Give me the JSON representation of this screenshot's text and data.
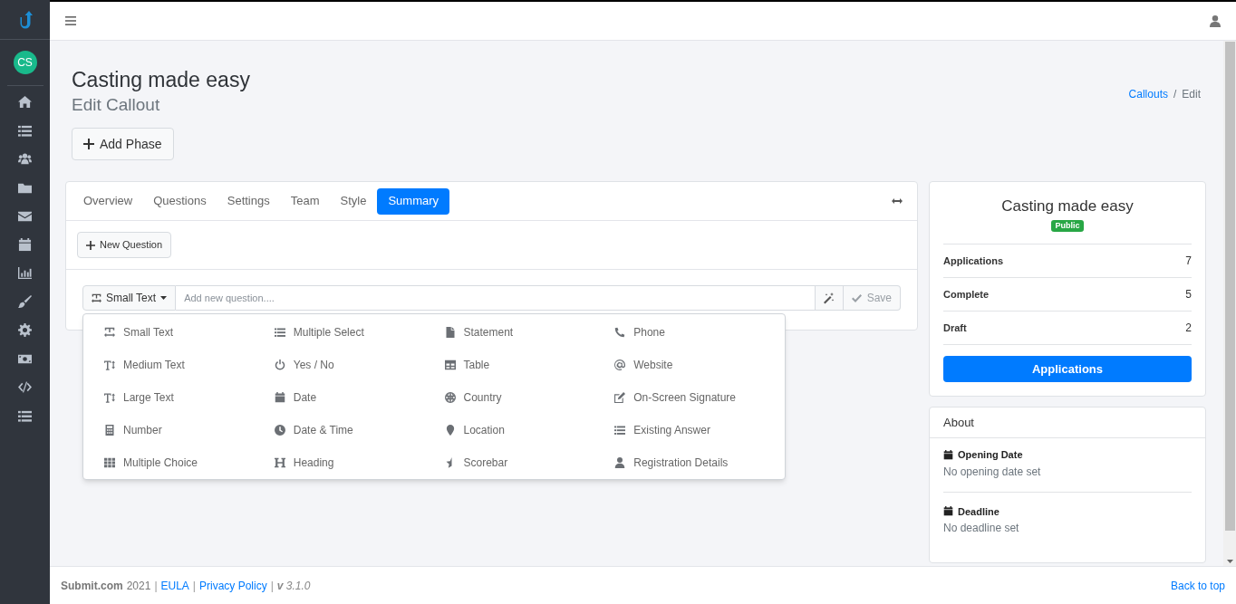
{
  "sidebar": {
    "avatar": "CS",
    "items": [
      {
        "selected": false
      },
      {
        "selected": false
      },
      {
        "selected": false
      },
      {
        "selected": false
      },
      {
        "selected": false
      },
      {
        "selected": false
      },
      {
        "selected": false
      },
      {
        "selected": false
      },
      {
        "selected": false
      },
      {
        "selected": false
      },
      {
        "selected": false
      },
      {
        "selected": false
      }
    ]
  },
  "header": {
    "title": "Casting made easy",
    "subtitle": "Edit Callout",
    "add_phase": "Add Phase"
  },
  "breadcrumb": [
    {
      "kind": "link",
      "text": "Callouts"
    },
    {
      "kind": "separator",
      "text": "/"
    },
    {
      "kind": "current",
      "text": "Edit"
    }
  ],
  "tabs": [
    {
      "label": "Overview",
      "selected": false
    },
    {
      "label": "Questions",
      "selected": false
    },
    {
      "label": "Settings",
      "selected": false
    },
    {
      "label": "Team",
      "selected": false
    },
    {
      "label": "Style",
      "selected": false
    },
    {
      "label": "Summary",
      "selected": true
    }
  ],
  "new_question": "New Question",
  "question_bar": {
    "type": "Small Text",
    "placeholder": "Add new question....",
    "save": "Save"
  },
  "question_types": [
    "Small Text",
    "Multiple Select",
    "Statement",
    "Phone",
    "Medium Text",
    "Yes / No",
    "Table",
    "Website",
    "Large Text",
    "Date",
    "Country",
    "On-Screen Signature",
    "Number",
    "Date & Time",
    "Location",
    "Existing Answer",
    "Multiple Choice",
    "Heading",
    "Scorebar",
    "Registration Details"
  ],
  "summary": {
    "title": "Casting made easy",
    "badge": "Public",
    "stats": [
      {
        "label": "Applications",
        "value": "7"
      },
      {
        "label": "Complete",
        "value": "5"
      },
      {
        "label": "Draft",
        "value": "2"
      }
    ],
    "button": "Applications"
  },
  "about": {
    "title": "About",
    "items": [
      {
        "label": "Opening Date",
        "text": "No opening date set"
      },
      {
        "label": "Deadline",
        "text": "No deadline set"
      }
    ]
  },
  "footer": [
    {
      "kind": "brand",
      "text": "Submit.com"
    },
    {
      "kind": "text",
      "text": "2021"
    },
    {
      "kind": "separator",
      "text": "|"
    },
    {
      "kind": "link",
      "text": "EULA"
    },
    {
      "kind": "separator",
      "text": "|"
    },
    {
      "kind": "link",
      "text": "Privacy Policy"
    },
    {
      "kind": "separator",
      "text": "|"
    },
    {
      "kind": "version",
      "text": "**v** 3.1.0"
    }
  ],
  "back_to_top": "Back to top"
}
